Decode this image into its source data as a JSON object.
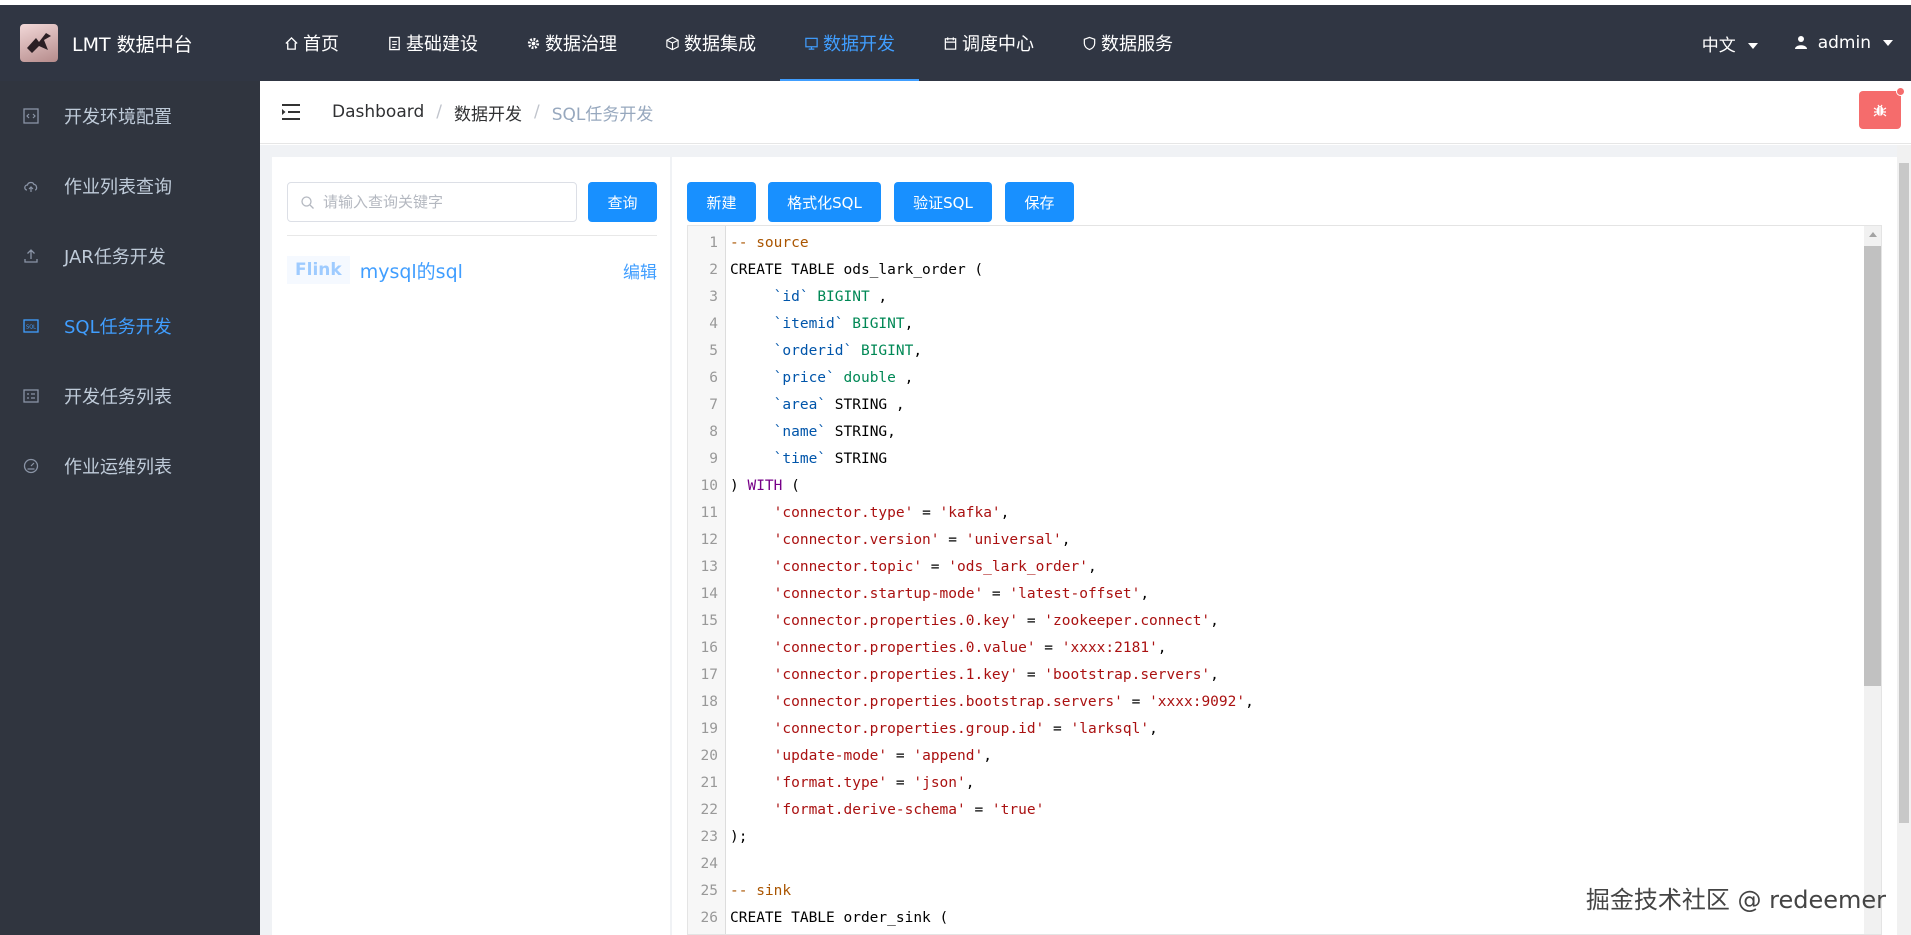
{
  "app": {
    "title": "LMT 数据中台"
  },
  "topnav": {
    "items": [
      {
        "label": "首页",
        "icon": "home-icon"
      },
      {
        "label": "基础建设",
        "icon": "document-icon"
      },
      {
        "label": "数据治理",
        "icon": "gear-icon"
      },
      {
        "label": "数据集成",
        "icon": "cube-icon"
      },
      {
        "label": "数据开发",
        "icon": "monitor-icon",
        "active": true
      },
      {
        "label": "调度中心",
        "icon": "calendar-icon"
      },
      {
        "label": "数据服务",
        "icon": "shield-icon"
      }
    ],
    "language": "中文",
    "user": "admin"
  },
  "sidebar": {
    "items": [
      {
        "label": "开发环境配置",
        "icon": "code-window-icon"
      },
      {
        "label": "作业列表查询",
        "icon": "cloud-upload-icon"
      },
      {
        "label": "JAR任务开发",
        "icon": "upload-icon"
      },
      {
        "label": "SQL任务开发",
        "icon": "sql-icon",
        "active": true
      },
      {
        "label": "开发任务列表",
        "icon": "list-card-icon"
      },
      {
        "label": "作业运维列表",
        "icon": "dashboard-icon"
      }
    ]
  },
  "breadcrumb": {
    "items": [
      "Dashboard",
      "数据开发",
      "SQL任务开发"
    ]
  },
  "left_panel": {
    "search_placeholder": "请输入查询关键字",
    "query_label": "查询",
    "tasks": [
      {
        "type": "Flink",
        "name": "mysql的sql",
        "edit_label": "编辑"
      }
    ]
  },
  "toolbar": {
    "new_label": "新建",
    "format_label": "格式化SQL",
    "validate_label": "验证SQL",
    "save_label": "保存"
  },
  "editor": {
    "lines": [
      "-- source",
      "CREATE TABLE ods_lark_order (",
      "     `id` BIGINT ,",
      "     `itemid` BIGINT,",
      "     `orderid` BIGINT,",
      "     `price` double ,",
      "     `area` STRING ,",
      "     `name` STRING,",
      "     `time` STRING",
      ") WITH (",
      "     'connector.type' = 'kafka',",
      "     'connector.version' = 'universal',",
      "     'connector.topic' = 'ods_lark_order',",
      "     'connector.startup-mode' = 'latest-offset',",
      "     'connector.properties.0.key' = 'zookeeper.connect',",
      "     'connector.properties.0.value' = 'xxxx:2181',",
      "     'connector.properties.1.key' = 'bootstrap.servers',",
      "     'connector.properties.bootstrap.servers' = 'xxxx:9092',",
      "     'connector.properties.group.id' = 'larksql',",
      "     'update-mode' = 'append',",
      "     'format.type' = 'json',",
      "     'format.derive-schema' = 'true'",
      ");",
      "",
      "-- sink",
      "CREATE TABLE order_sink ("
    ]
  },
  "watermark": "掘金技术社区 @ redeemer",
  "colors": {
    "topbar": "#303643",
    "sidebar": "#30353f",
    "accent": "#409eff",
    "button": "#1890ff",
    "danger": "#f56c6c"
  }
}
